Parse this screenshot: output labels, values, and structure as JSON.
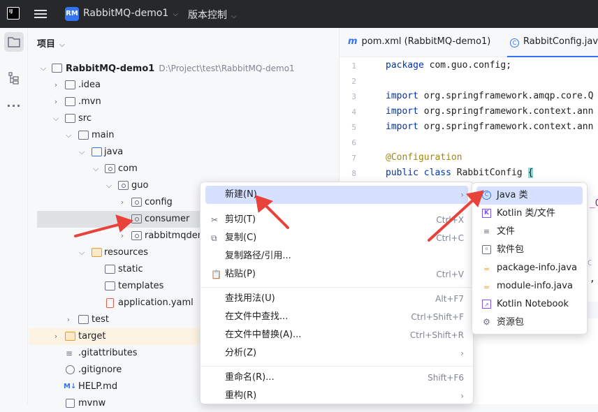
{
  "titlebar": {
    "logo": "IJ",
    "project_badge": "RM",
    "project_name": "RabbitMQ-demo1",
    "vcs_label": "版本控制"
  },
  "panel": {
    "title": "项目"
  },
  "tree": [
    {
      "label": "RabbitMQ-demo1",
      "path": "D:\\Project\\test\\RabbitMQ-demo1"
    },
    {
      "label": ".idea"
    },
    {
      "label": ".mvn"
    },
    {
      "label": "src"
    },
    {
      "label": "main"
    },
    {
      "label": "java"
    },
    {
      "label": "com"
    },
    {
      "label": "guo"
    },
    {
      "label": "config"
    },
    {
      "label": "consumer"
    },
    {
      "label": "rabbitmqdem"
    },
    {
      "label": "resources"
    },
    {
      "label": "static"
    },
    {
      "label": "templates"
    },
    {
      "label": "application.yaml"
    },
    {
      "label": "test"
    },
    {
      "label": "target"
    },
    {
      "label": ".gitattributes"
    },
    {
      "label": ".gitignore"
    },
    {
      "label": "HELP.md"
    },
    {
      "label": "mvnw"
    }
  ],
  "tabs": [
    {
      "label": "pom.xml (RabbitMQ-demo1)"
    },
    {
      "label": "RabbitConfig.java"
    }
  ],
  "code": {
    "line_numbers": [
      "1",
      "2",
      "3",
      "4",
      "5",
      "6",
      "7",
      "8"
    ],
    "l1a": "package",
    "l1b": " com.guo.config;",
    "import_kw": "import",
    "l3": " org.springframework.amqp.core.Q",
    "l4": " org.springframework.context.ann",
    "l5": " org.springframework.context.ann",
    "l7": "@Configuration",
    "l8a": "public class",
    "l8b": " RabbitConfig ",
    "l8c": "{",
    "frag1": "_Q",
    "frag2": "C",
    "frag3": ","
  },
  "context_menu": [
    {
      "label": "新建(N)",
      "shortcut": ""
    },
    {
      "label": "剪切(T)",
      "shortcut": "Ctrl+X"
    },
    {
      "label": "复制(C)",
      "shortcut": "Ctrl+C"
    },
    {
      "label": "复制路径/引用...",
      "shortcut": ""
    },
    {
      "label": "粘贴(P)",
      "shortcut": "Ctrl+V"
    },
    {
      "label": "查找用法(U)",
      "shortcut": "Alt+F7"
    },
    {
      "label": "在文件中查找...",
      "shortcut": "Ctrl+Shift+F"
    },
    {
      "label": "在文件中替换(A)...",
      "shortcut": "Ctrl+Shift+R"
    },
    {
      "label": "分析(Z)",
      "shortcut": ""
    },
    {
      "label": "重命名(R)...",
      "shortcut": "Shift+F6"
    },
    {
      "label": "重构(R)",
      "shortcut": ""
    }
  ],
  "submenu": [
    {
      "label": "Java 类",
      "icon": "java-class-icon"
    },
    {
      "label": "Kotlin 类/文件",
      "icon": "kotlin-icon"
    },
    {
      "label": "文件",
      "icon": "file-icon"
    },
    {
      "label": "软件包",
      "icon": "package-icon"
    },
    {
      "label": "package-info.java",
      "icon": "java-cup-icon"
    },
    {
      "label": "module-info.java",
      "icon": "java-cup-icon"
    },
    {
      "label": "Kotlin Notebook",
      "icon": "notebook-icon"
    },
    {
      "label": "资源包",
      "icon": "resource-bundle-icon"
    }
  ],
  "colors": {
    "accent": "#3574f0",
    "annotation_arrow": "#e8433a",
    "highlight": "#d5e1ff"
  }
}
